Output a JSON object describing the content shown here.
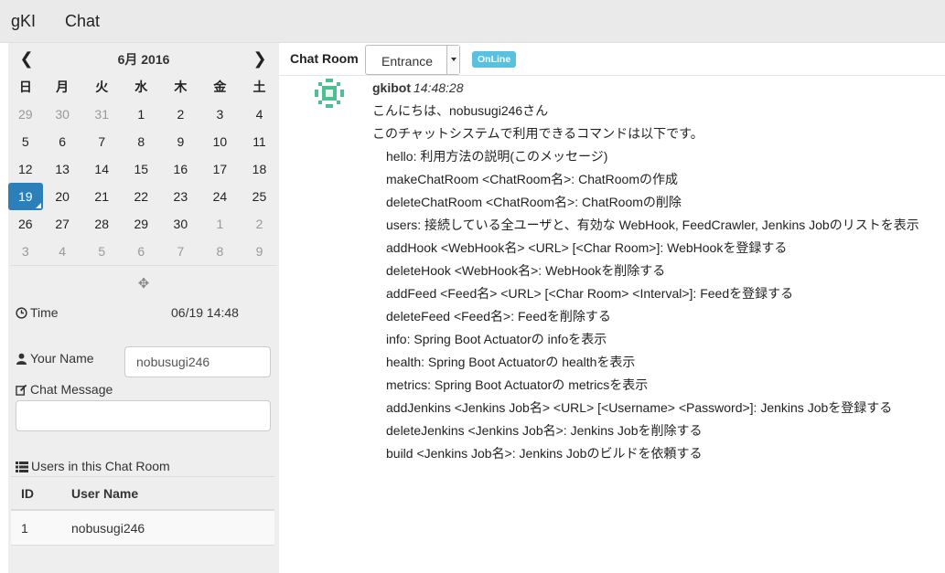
{
  "navbar": {
    "brand": "gKI",
    "chat_link": "Chat"
  },
  "calendar": {
    "prev_icon": "chevron-left-icon",
    "next_icon": "chevron-right-icon",
    "title": "6月 2016",
    "weekdays": [
      "日",
      "月",
      "火",
      "水",
      "木",
      "金",
      "土"
    ],
    "weeks": [
      [
        {
          "d": "29",
          "m": true
        },
        {
          "d": "30",
          "m": true
        },
        {
          "d": "31",
          "m": true
        },
        {
          "d": "1"
        },
        {
          "d": "2"
        },
        {
          "d": "3"
        },
        {
          "d": "4"
        }
      ],
      [
        {
          "d": "5"
        },
        {
          "d": "6"
        },
        {
          "d": "7"
        },
        {
          "d": "8"
        },
        {
          "d": "9"
        },
        {
          "d": "10"
        },
        {
          "d": "11"
        }
      ],
      [
        {
          "d": "12"
        },
        {
          "d": "13"
        },
        {
          "d": "14"
        },
        {
          "d": "15"
        },
        {
          "d": "16"
        },
        {
          "d": "17"
        },
        {
          "d": "18"
        }
      ],
      [
        {
          "d": "19",
          "t": true
        },
        {
          "d": "20"
        },
        {
          "d": "21"
        },
        {
          "d": "22"
        },
        {
          "d": "23"
        },
        {
          "d": "24"
        },
        {
          "d": "25"
        }
      ],
      [
        {
          "d": "26"
        },
        {
          "d": "27"
        },
        {
          "d": "28"
        },
        {
          "d": "29"
        },
        {
          "d": "30"
        },
        {
          "d": "1",
          "m": true
        },
        {
          "d": "2",
          "m": true
        }
      ],
      [
        {
          "d": "3",
          "m": true
        },
        {
          "d": "4",
          "m": true
        },
        {
          "d": "5",
          "m": true
        },
        {
          "d": "6",
          "m": true
        },
        {
          "d": "7",
          "m": true
        },
        {
          "d": "8",
          "m": true
        },
        {
          "d": "9",
          "m": true
        }
      ]
    ],
    "today_color": "#2c7fb8"
  },
  "sidebar": {
    "time_label": "Time",
    "time_value": "06/19 14:48",
    "name_label": "Your Name",
    "name_value": "nobusugi246",
    "message_label": "Chat Message",
    "message_value": "",
    "users_label": "Users in this Chat Room",
    "users_columns": [
      "ID",
      "User Name"
    ],
    "users": [
      {
        "id": "1",
        "name": "nobusugi246"
      }
    ]
  },
  "room": {
    "label": "Chat Room",
    "selected": "Entrance",
    "status": "OnLine",
    "status_color": "#5bc0de"
  },
  "message": {
    "author": "gkibot",
    "time": "14:48:28",
    "greeting": "こんにちは、nobusugi246さん",
    "intro": "このチャットシステムで利用できるコマンドは以下です。",
    "commands": [
      "hello: 利用方法の説明(このメッセージ)",
      "makeChatRoom <ChatRoom名>: ChatRoomの作成",
      "deleteChatRoom <ChatRoom名>: ChatRoomの削除",
      "users: 接続している全ユーザと、有効な WebHook, FeedCrawler, Jenkins Jobのリストを表示",
      "addHook <WebHook名> <URL> [<Char Room>]: WebHookを登録する",
      "deleteHook <WebHook名>: WebHookを削除する",
      "addFeed <Feed名> <URL> [<Char Room> <Interval>]: Feedを登録する",
      "deleteFeed <Feed名>: Feedを削除する",
      "info: Spring Boot Actuatorの infoを表示",
      "health: Spring Boot Actuatorの healthを表示",
      "metrics: Spring Boot Actuatorの metricsを表示",
      "addJenkins <Jenkins Job名> <URL> [<Username> <Password>]: Jenkins Jobを登録する",
      "deleteJenkins <Jenkins Job名>: Jenkins Jobを削除する",
      "build <Jenkins Job名>: Jenkins Jobのビルドを依頼する"
    ]
  }
}
